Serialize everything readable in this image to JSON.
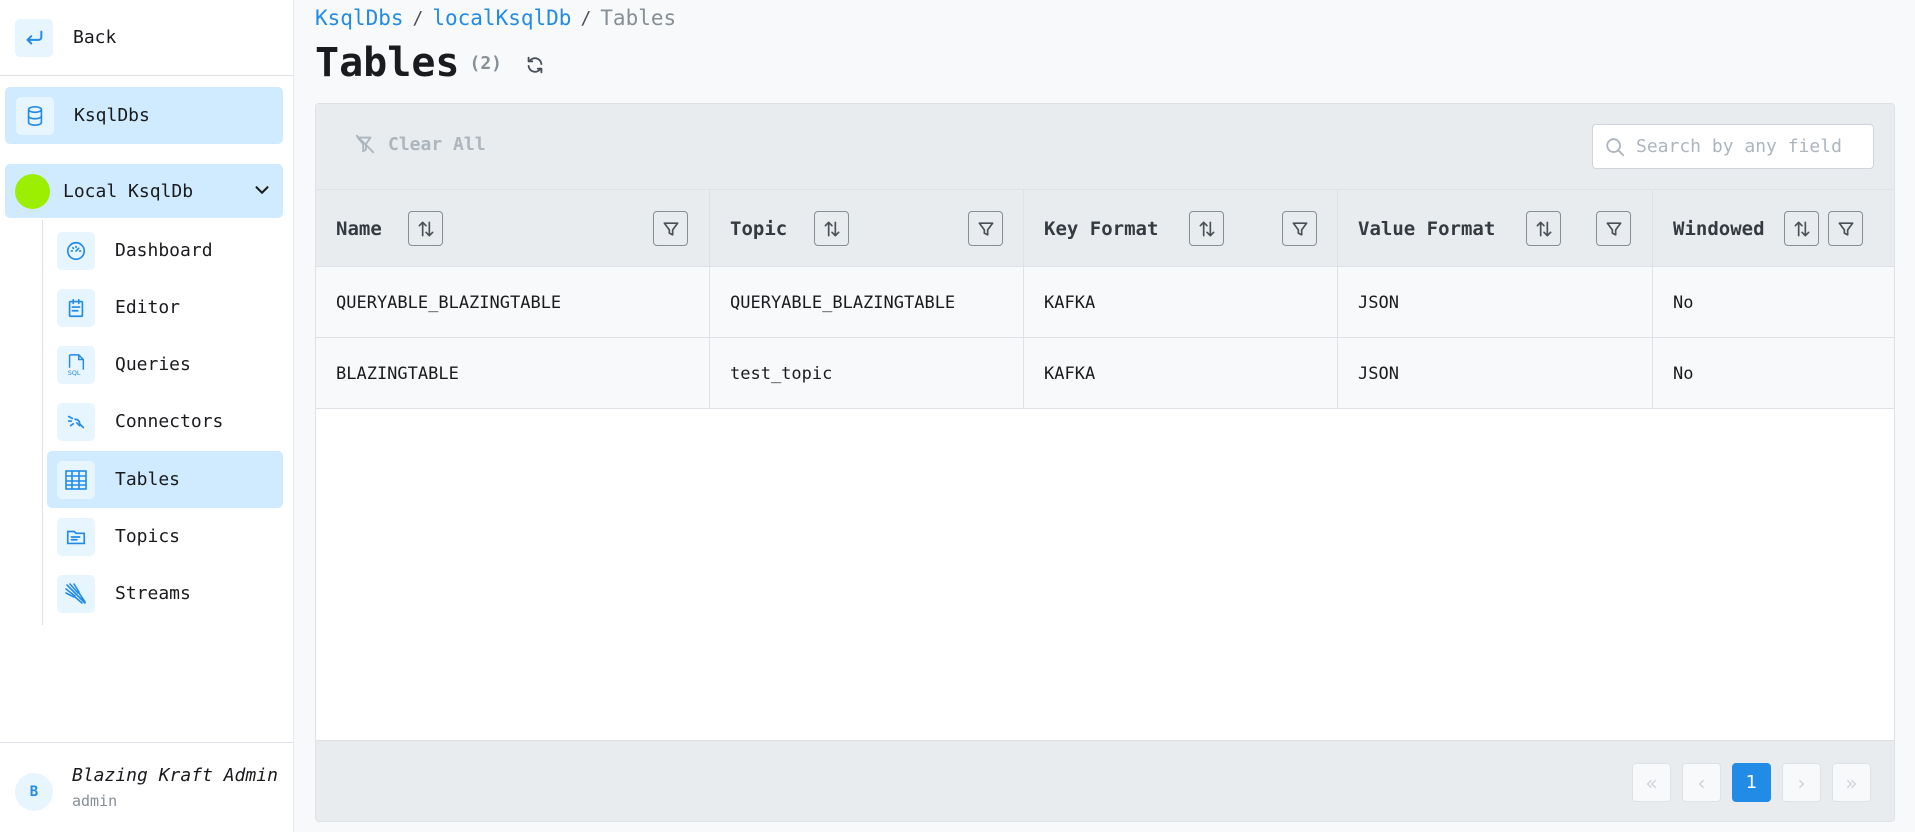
{
  "sidebar": {
    "back_label": "Back",
    "ksqldbs_label": "KsqlDbs",
    "cluster_label": "Local KsqlDb",
    "cluster_color": "#9cef00",
    "items": [
      {
        "label": "Dashboard",
        "icon": "dashboard-icon"
      },
      {
        "label": "Editor",
        "icon": "editor-icon"
      },
      {
        "label": "Queries",
        "icon": "sql-file-icon"
      },
      {
        "label": "Connectors",
        "icon": "connectors-icon"
      },
      {
        "label": "Tables",
        "icon": "table-icon",
        "active": true
      },
      {
        "label": "Topics",
        "icon": "topics-icon"
      },
      {
        "label": "Streams",
        "icon": "streams-icon"
      }
    ]
  },
  "user": {
    "initial": "B",
    "name": "Blazing Kraft Admin",
    "role": "admin"
  },
  "breadcrumb": {
    "items": [
      "KsqlDbs",
      "localKsqlDb"
    ],
    "current": "Tables",
    "separator": "/"
  },
  "page": {
    "title": "Tables",
    "count": "(2)"
  },
  "toolbar": {
    "clear_all": "Clear All",
    "search_placeholder": "Search by any field"
  },
  "table": {
    "columns": [
      "Name",
      "Topic",
      "Key Format",
      "Value Format",
      "Windowed"
    ],
    "rows": [
      [
        "QUERYABLE_BLAZINGTABLE",
        "QUERYABLE_BLAZINGTABLE",
        "KAFKA",
        "JSON",
        "No"
      ],
      [
        "BLAZINGTABLE",
        "test_topic",
        "KAFKA",
        "JSON",
        "No"
      ]
    ]
  },
  "pagination": {
    "first": "«",
    "prev": "‹",
    "current": "1",
    "next": "›",
    "last": "»"
  },
  "colors": {
    "accent": "#228be6",
    "active_bg": "#d0ebff"
  }
}
